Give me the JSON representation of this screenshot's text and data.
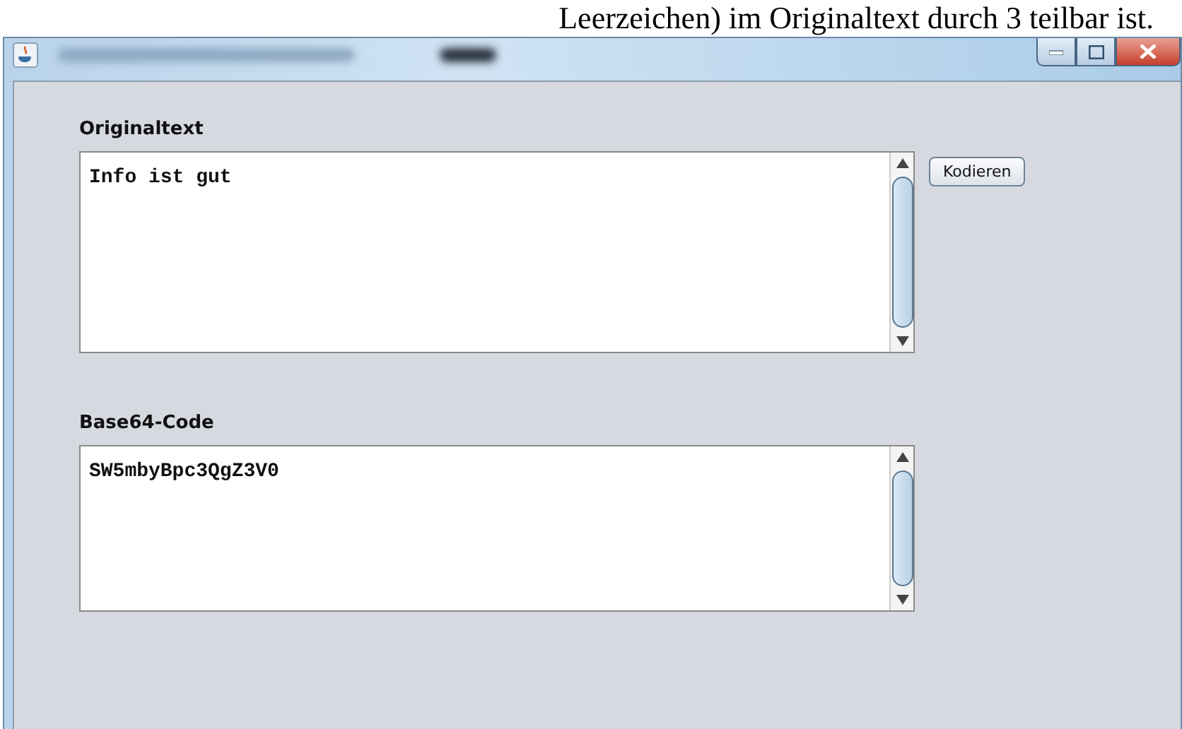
{
  "document_text_above": "Leerzeichen) im Originaltext durch 3 teilbar ist.",
  "window": {
    "controls": [
      {
        "kind": "minimize"
      },
      {
        "kind": "maximize"
      },
      {
        "kind": "close"
      }
    ]
  },
  "sections": [
    {
      "label": "Originaltext",
      "value": "Info ist gut",
      "button": "Kodieren"
    },
    {
      "label": "Base64-Code",
      "value": "SW5mbyBpc3QgZ3V0"
    }
  ]
}
